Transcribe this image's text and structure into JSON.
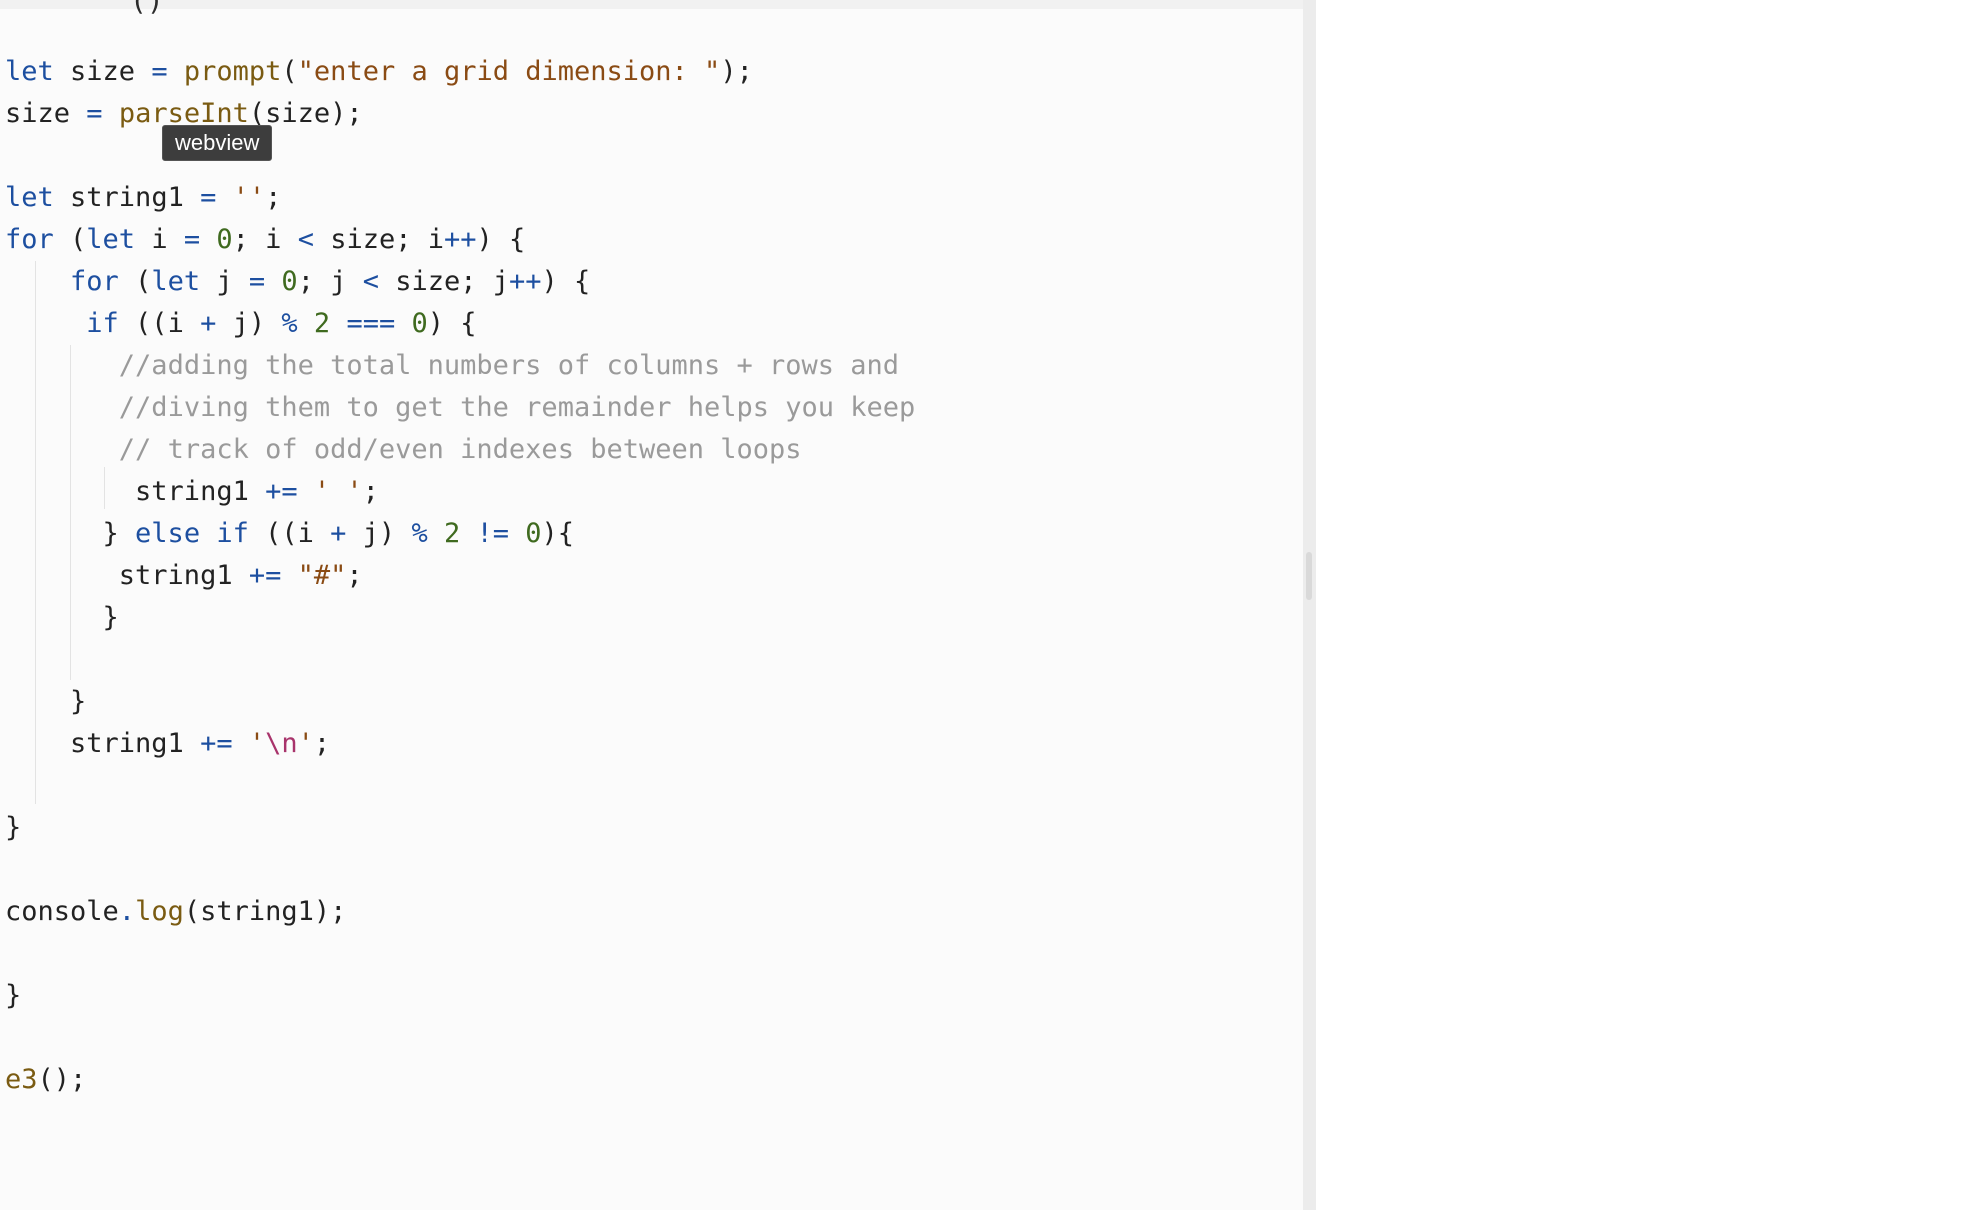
{
  "editor": {
    "top_partial_text": "()",
    "lines": [
      [
        {
          "t": "let",
          "c": "kw"
        },
        {
          "t": " size "
        },
        {
          "t": "=",
          "c": "op"
        },
        {
          "t": " "
        },
        {
          "t": "prompt",
          "c": "fn"
        },
        {
          "t": "("
        },
        {
          "t": "\"enter a grid dimension: \"",
          "c": "str"
        },
        {
          "t": ");"
        }
      ],
      [
        {
          "t": "size "
        },
        {
          "t": "=",
          "c": "op"
        },
        {
          "t": " "
        },
        {
          "t": "parseInt",
          "c": "fn"
        },
        {
          "t": "(size);"
        }
      ],
      [],
      [
        {
          "t": "let",
          "c": "kw"
        },
        {
          "t": " string1 "
        },
        {
          "t": "=",
          "c": "op"
        },
        {
          "t": " "
        },
        {
          "t": "''",
          "c": "str"
        },
        {
          "t": ";"
        }
      ],
      [
        {
          "t": "for",
          "c": "kw"
        },
        {
          "t": " ("
        },
        {
          "t": "let",
          "c": "kw"
        },
        {
          "t": " i "
        },
        {
          "t": "=",
          "c": "op"
        },
        {
          "t": " "
        },
        {
          "t": "0",
          "c": "num"
        },
        {
          "t": "; i "
        },
        {
          "t": "<",
          "c": "op"
        },
        {
          "t": " size; i"
        },
        {
          "t": "++",
          "c": "op"
        },
        {
          "t": ") {"
        }
      ],
      [
        {
          "t": "    "
        },
        {
          "t": "for",
          "c": "kw"
        },
        {
          "t": " ("
        },
        {
          "t": "let",
          "c": "kw"
        },
        {
          "t": " j "
        },
        {
          "t": "=",
          "c": "op"
        },
        {
          "t": " "
        },
        {
          "t": "0",
          "c": "num"
        },
        {
          "t": "; j "
        },
        {
          "t": "<",
          "c": "op"
        },
        {
          "t": " size; j"
        },
        {
          "t": "++",
          "c": "op"
        },
        {
          "t": ") {"
        }
      ],
      [
        {
          "t": "     "
        },
        {
          "t": "if",
          "c": "kw"
        },
        {
          "t": " ((i "
        },
        {
          "t": "+",
          "c": "op"
        },
        {
          "t": " j) "
        },
        {
          "t": "%",
          "c": "op"
        },
        {
          "t": " "
        },
        {
          "t": "2",
          "c": "num"
        },
        {
          "t": " "
        },
        {
          "t": "===",
          "c": "op"
        },
        {
          "t": " "
        },
        {
          "t": "0",
          "c": "num"
        },
        {
          "t": ") {"
        }
      ],
      [
        {
          "t": "       "
        },
        {
          "t": "//adding the total numbers of columns + rows and",
          "c": "cm"
        }
      ],
      [
        {
          "t": "       "
        },
        {
          "t": "//diving them to get the remainder helps you keep",
          "c": "cm"
        }
      ],
      [
        {
          "t": "       "
        },
        {
          "t": "// track of odd/even indexes between loops",
          "c": "cm"
        }
      ],
      [
        {
          "t": "        string1 "
        },
        {
          "t": "+=",
          "c": "op"
        },
        {
          "t": " "
        },
        {
          "t": "' '",
          "c": "str"
        },
        {
          "t": ";"
        }
      ],
      [
        {
          "t": "      } "
        },
        {
          "t": "else",
          "c": "kw"
        },
        {
          "t": " "
        },
        {
          "t": "if",
          "c": "kw"
        },
        {
          "t": " ((i "
        },
        {
          "t": "+",
          "c": "op"
        },
        {
          "t": " j) "
        },
        {
          "t": "%",
          "c": "op"
        },
        {
          "t": " "
        },
        {
          "t": "2",
          "c": "num"
        },
        {
          "t": " "
        },
        {
          "t": "!=",
          "c": "op"
        },
        {
          "t": " "
        },
        {
          "t": "0",
          "c": "num"
        },
        {
          "t": "){"
        }
      ],
      [
        {
          "t": "       string1 "
        },
        {
          "t": "+=",
          "c": "op"
        },
        {
          "t": " "
        },
        {
          "t": "\"#\"",
          "c": "str"
        },
        {
          "t": ";"
        }
      ],
      [
        {
          "t": "      }"
        }
      ],
      [],
      [
        {
          "t": "    }"
        }
      ],
      [
        {
          "t": "    string1 "
        },
        {
          "t": "+=",
          "c": "op"
        },
        {
          "t": " "
        },
        {
          "t": "'",
          "c": "str"
        },
        {
          "t": "\\n",
          "c": "esc"
        },
        {
          "t": "'",
          "c": "str"
        },
        {
          "t": ";"
        }
      ],
      [],
      [
        {
          "t": "}"
        }
      ],
      [],
      [
        {
          "t": "console"
        },
        {
          "t": ".",
          "c": "op"
        },
        {
          "t": "log",
          "c": "fn"
        },
        {
          "t": "(string1);"
        }
      ],
      [],
      [
        {
          "t": "}"
        }
      ],
      [],
      [
        {
          "t": "e3",
          "c": "fn"
        },
        {
          "t": "();"
        }
      ]
    ]
  },
  "tooltip": {
    "label": "webview"
  }
}
